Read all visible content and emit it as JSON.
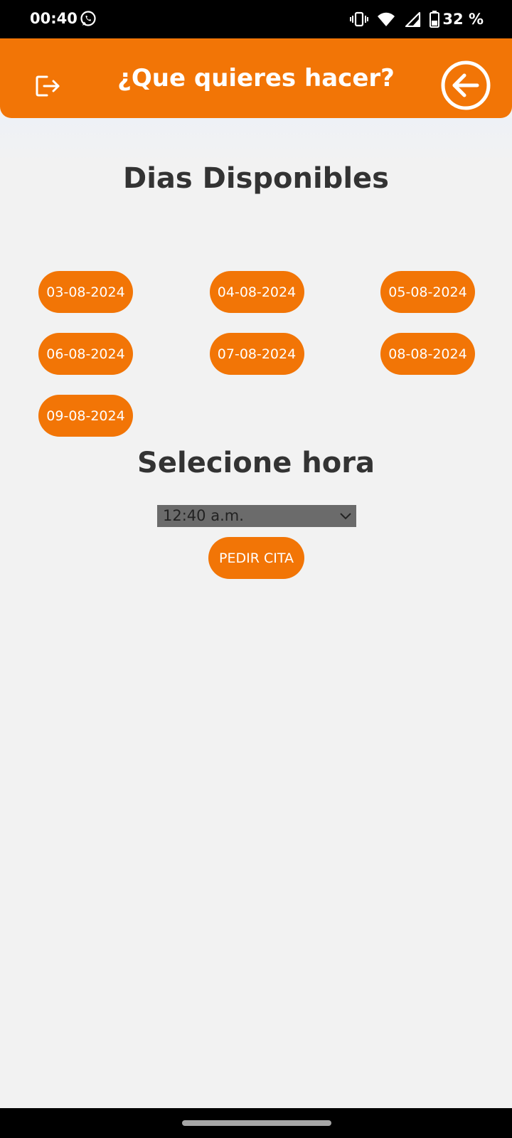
{
  "status_bar": {
    "time": "00:40",
    "battery": "32 %",
    "icons": [
      "whatsapp-icon",
      "vibrate-icon",
      "wifi-icon",
      "signal-icon",
      "battery-icon"
    ]
  },
  "header": {
    "title": "¿Que quieres hacer?",
    "left_icon": "logout-icon",
    "right_icon": "back-arrow-icon",
    "color": "#f27506"
  },
  "available_days": {
    "title": "Dias Disponibles",
    "days": [
      "03-08-2024",
      "04-08-2024",
      "05-08-2024",
      "06-08-2024",
      "07-08-2024",
      "08-08-2024",
      "09-08-2024"
    ]
  },
  "time_selection": {
    "title": "Selecione hora",
    "selected": "12:40 a.m."
  },
  "actions": {
    "book_label": "PEDIR CITA"
  },
  "colors": {
    "accent": "#f27506",
    "background": "#f2f2f2",
    "text": "#333333"
  }
}
